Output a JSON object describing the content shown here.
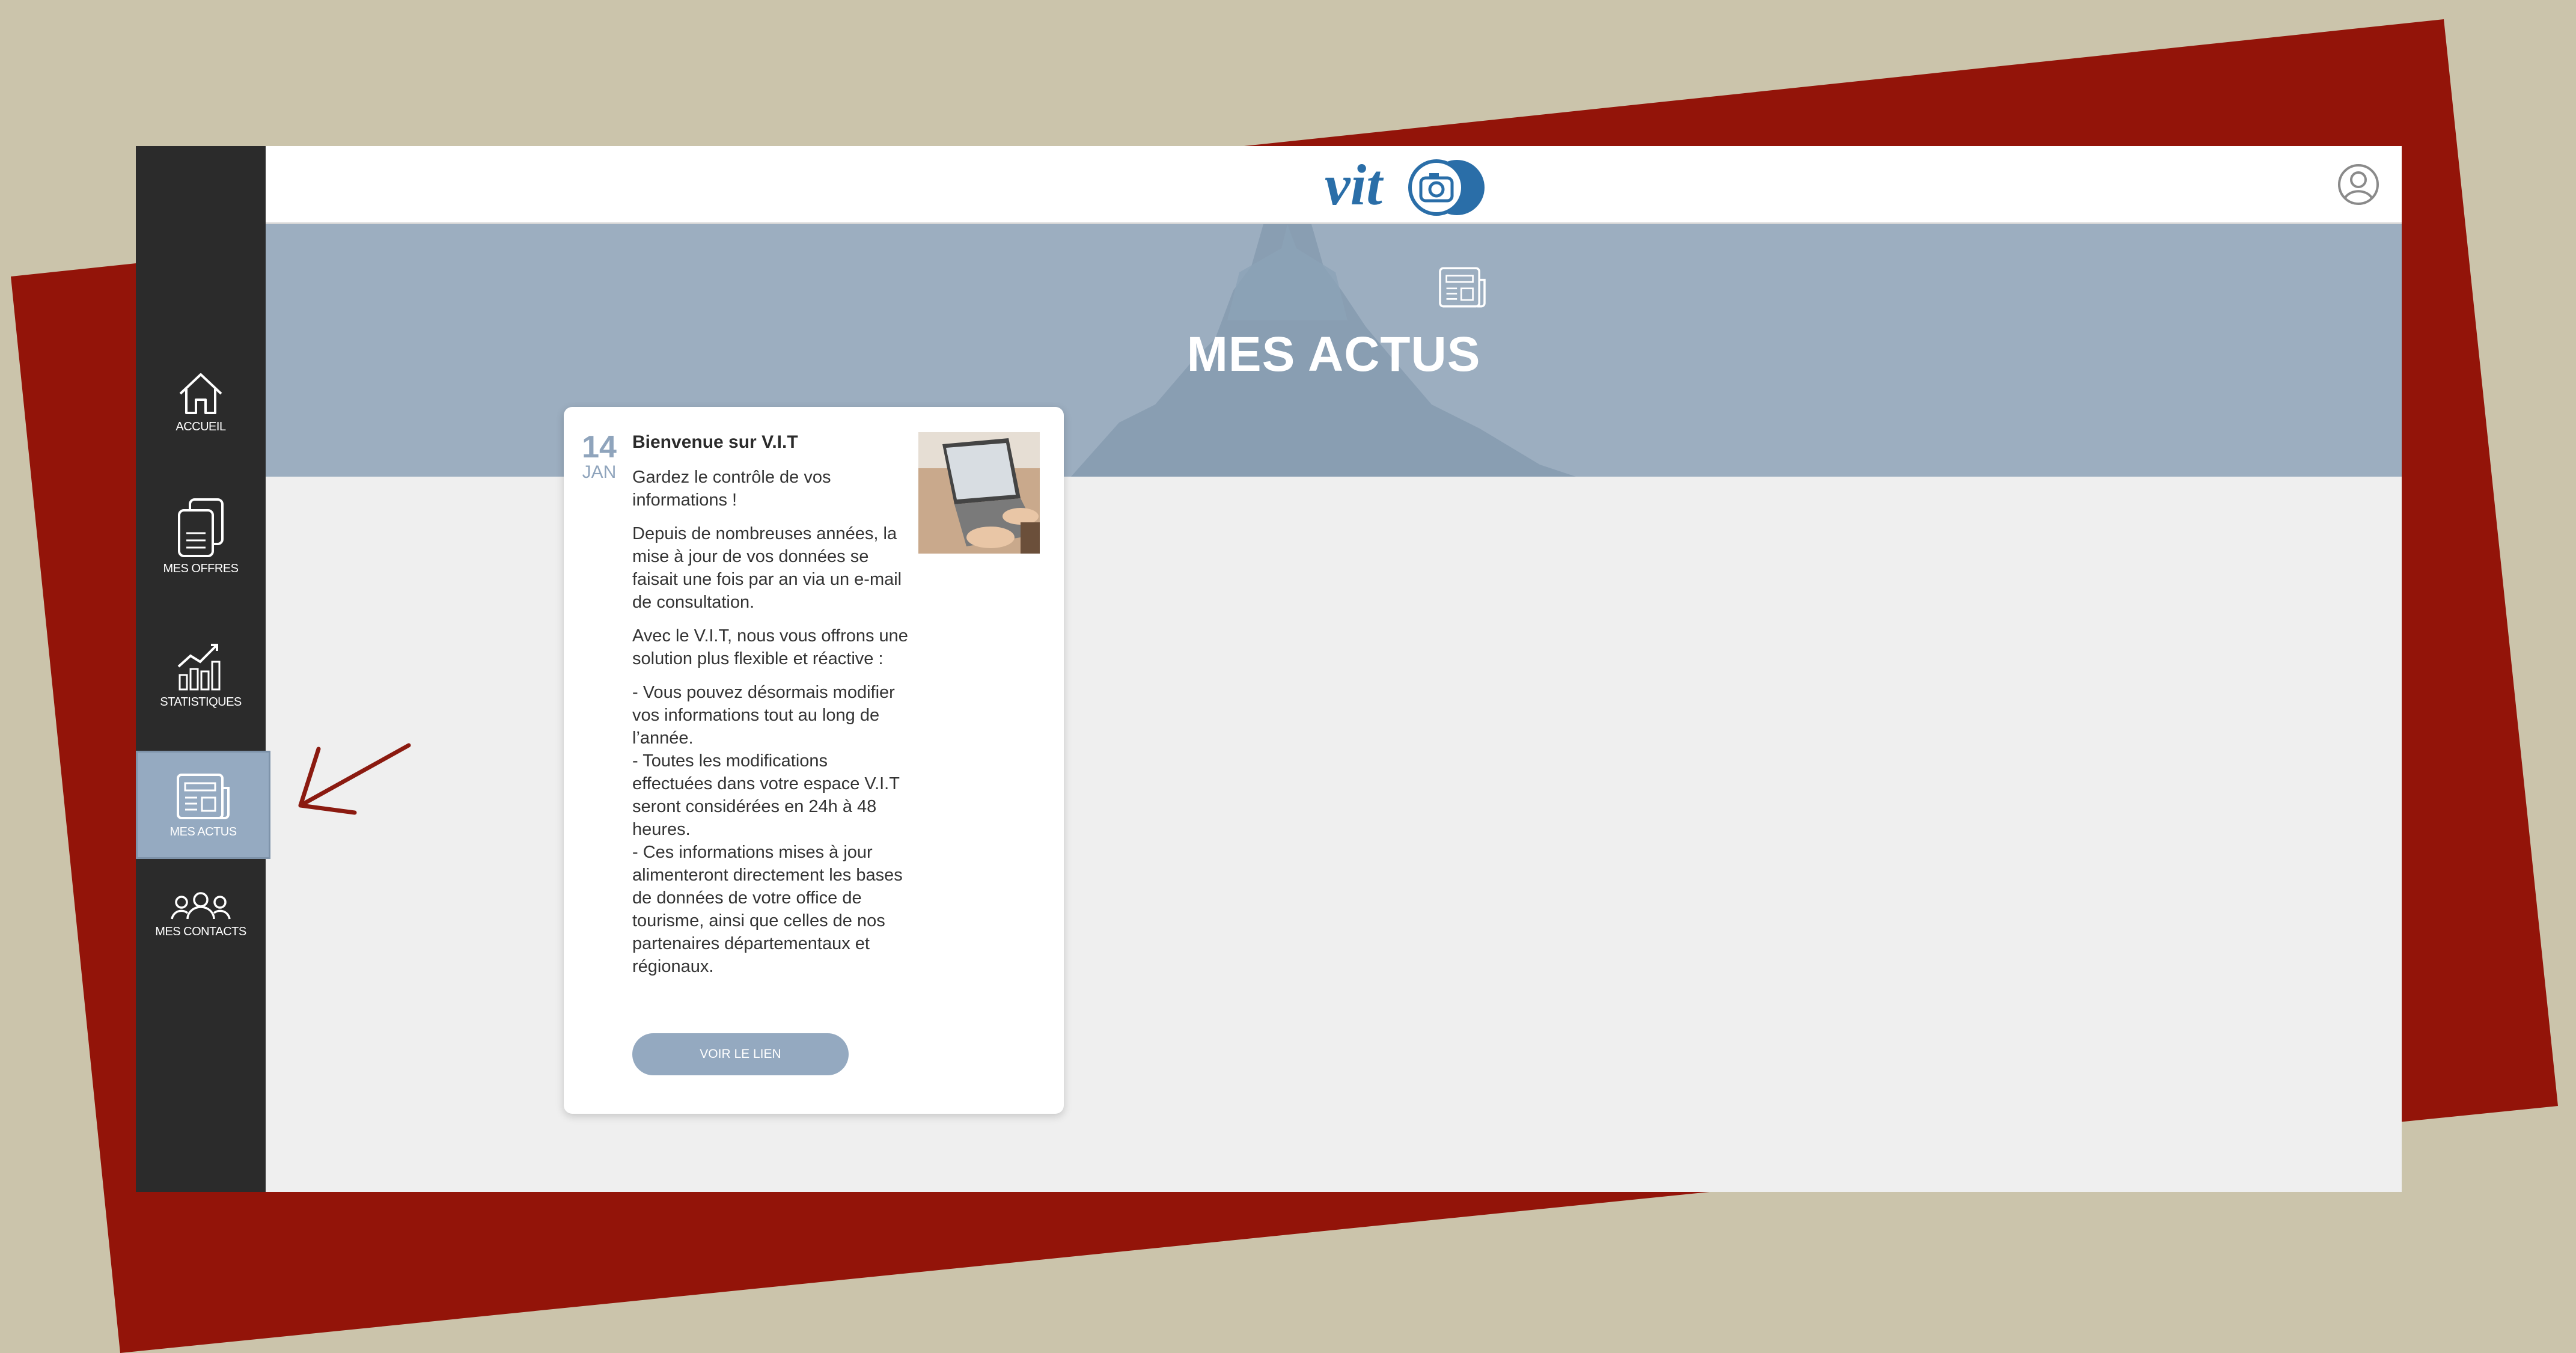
{
  "colors": {
    "background": "#cbc4ab",
    "red_shape": "#931409",
    "sidebar": "#2b2b2b",
    "active_item": "#95aac1",
    "hero": "#9caec0",
    "logo_blue": "#2a6ea8",
    "arrow": "#8b1a10"
  },
  "sidebar": {
    "items": [
      {
        "label": "ACCUEIL",
        "icon": "home-icon"
      },
      {
        "label": "MES OFFRES",
        "icon": "documents-icon"
      },
      {
        "label": "STATISTIQUES",
        "icon": "chart-icon"
      },
      {
        "label": "MES ACTUS",
        "icon": "newspaper-icon",
        "active": true
      },
      {
        "label": "MES CONTACTS",
        "icon": "contacts-icon"
      }
    ]
  },
  "header": {
    "logo_text": "vit",
    "account_icon": "user-circle-icon"
  },
  "hero": {
    "title": "MES ACTUS",
    "icon": "newspaper-icon"
  },
  "news": {
    "day": "14",
    "month": "JAN",
    "title": "Bienvenue sur V.I.T",
    "paragraphs": [
      "Gardez le contrôle de vos informations !",
      "Depuis de nombreuses années, la mise à jour de vos données se faisait une fois par an via un e-mail de consultation.",
      "Avec le V.I.T, nous vous offrons une solution plus flexible et réactive :",
      "- Vous pouvez désormais modifier vos informations tout au long de l’année.\n- Toutes les modifications effectuées dans votre espace V.I.T seront considérées en 24h à 48 heures.\n- Ces informations mises à jour alimenteront directement les bases de données de votre office de tourisme, ainsi que celles de nos partenaires départementaux et régionaux."
    ],
    "button_label": "VOIR LE LIEN"
  }
}
